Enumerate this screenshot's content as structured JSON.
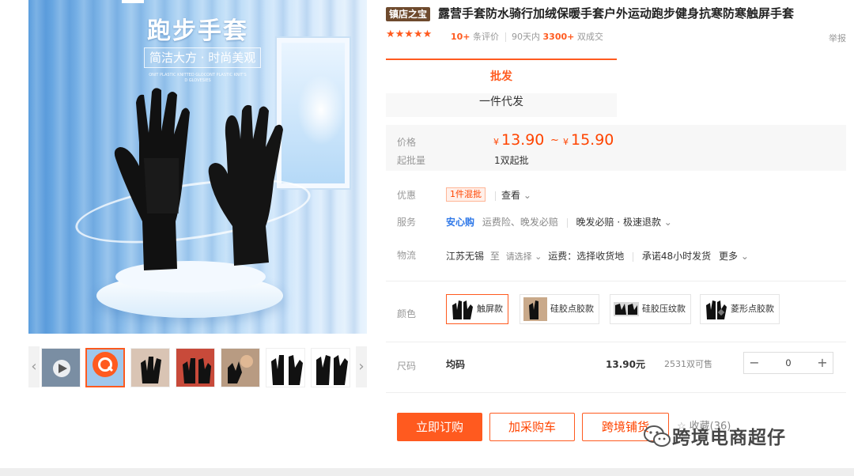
{
  "image": {
    "title": "跑步手套",
    "subtitle": "简洁大方 · 时尚美观",
    "fine_print_1": "ONIT PLASTIC KNITTED GLOCONT PLASTIC KNIT'S",
    "fine_print_2": "D GLOVESIES"
  },
  "shop_badge": "镇店之宝",
  "product_title": "露营手套防水骑行加绒保暖手套户外运动跑步健身抗寒防寒触屏手套",
  "report_label": "举报",
  "rating": {
    "stars": "★★★★★",
    "review_count": "10+",
    "review_label": "条评价",
    "sales_prefix": "90天内",
    "sales_count": "3300+",
    "sales_label": "双成交"
  },
  "tabs": {
    "wholesale": "批发",
    "dropship": "一件代发"
  },
  "price": {
    "label": "价格",
    "currency": "¥",
    "min": "13.90",
    "separator": "~",
    "max": "15.90",
    "moq_label": "起批量",
    "moq_value": "1双起批"
  },
  "promo": {
    "label": "优惠",
    "tag": "1件混批",
    "view": "查看"
  },
  "service": {
    "label": "服务",
    "safe": "安心购",
    "items": "运费险、晚发必赔",
    "extra": "晚发必赔 · 极速退款"
  },
  "logistics": {
    "label": "物流",
    "from": "江苏无锡",
    "to_word": "至",
    "to_select": "请选择",
    "freight": "运费：选择收货地",
    "promise": "承诺48小时发货",
    "more": "更多"
  },
  "color": {
    "label": "颜色",
    "options": [
      "触屏款",
      "硅胶点胶款",
      "硅胶压纹款",
      "菱形点胶款"
    ]
  },
  "size": {
    "label": "尺码",
    "name": "均码",
    "price": "13.90元",
    "stock": "2531双可售",
    "quantity": "0"
  },
  "actions": {
    "order": "立即订购",
    "cart": "加采购车",
    "crossborder": "跨境铺货",
    "favorite": "收藏(36)"
  },
  "watermark": "跨境电商超仔",
  "colors": {
    "accent": "#ff5a1f",
    "price": "#ff4400",
    "safe_blue": "#2f78e8",
    "badge_brown": "#6e4a2d"
  },
  "icons": [
    "chevron-left-icon",
    "chevron-right-icon",
    "zoom-icon",
    "star-icon",
    "chevron-down-icon",
    "minus-icon",
    "plus-icon",
    "wechat-icon"
  ]
}
